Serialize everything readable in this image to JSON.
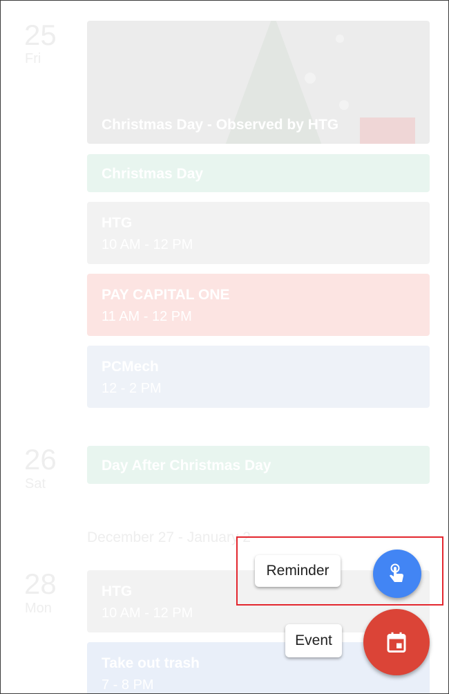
{
  "days": [
    {
      "number": "25",
      "name": "Fri"
    },
    {
      "number": "26",
      "name": "Sat"
    },
    {
      "number": "28",
      "name": "Mon"
    }
  ],
  "events": {
    "christmas_observed": {
      "title": "Christmas Day - Observed by HTG"
    },
    "christmas_day": {
      "title": "Christmas Day",
      "color": "#e8f5ef"
    },
    "htg_25": {
      "title": "HTG",
      "time": "10 AM - 12 PM",
      "color": "#f2f2f2"
    },
    "pay_capital_one": {
      "title": "PAY CAPITAL ONE",
      "time": "11 AM - 12 PM",
      "color": "#fce4e2"
    },
    "pcmech": {
      "title": "PCMech",
      "time": "12 - 2 PM",
      "color": "#eef2f8"
    },
    "day_after_christmas": {
      "title": "Day After Christmas Day",
      "color": "#e8f5ef"
    },
    "htg_28": {
      "title": "HTG",
      "time": "10 AM - 12 PM",
      "color": "#f2f2f2"
    },
    "take_out_trash": {
      "title": "Take out trash",
      "time": "7 - 8 PM",
      "color": "#e9eff9"
    }
  },
  "week_range": "December 27 - January 2",
  "fab_menu": {
    "reminder_label": "Reminder",
    "event_label": "Event",
    "reminder_color": "#4285f4",
    "event_color": "#db4437",
    "reminder_icon": "hand-touch-icon",
    "event_icon": "calendar-icon"
  }
}
